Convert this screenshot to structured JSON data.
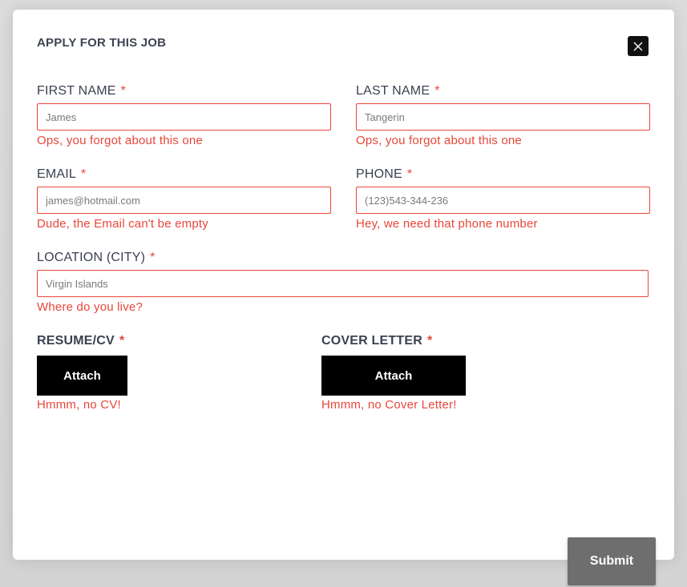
{
  "modal": {
    "title": "APPLY FOR THIS JOB",
    "close_icon": "close-icon"
  },
  "form": {
    "first_name": {
      "label": "FIRST NAME",
      "required_mark": "*",
      "placeholder": "James",
      "error": "Ops, you forgot about this one"
    },
    "last_name": {
      "label": "LAST NAME",
      "required_mark": "*",
      "placeholder": "Tangerin",
      "error": "Ops, you forgot about this one"
    },
    "email": {
      "label": "EMAIL",
      "required_mark": "*",
      "placeholder": "james@hotmail.com",
      "error": "Dude, the Email can't be empty"
    },
    "phone": {
      "label": "PHONE",
      "required_mark": "*",
      "placeholder": "(123)543-344-236",
      "error": "Hey, we need that phone number"
    },
    "location": {
      "label": "LOCATION (CITY)",
      "required_mark": "*",
      "placeholder": "Virgin Islands",
      "error": "Where do you live?"
    },
    "resume": {
      "label": "RESUME/CV",
      "required_mark": "*",
      "button_label": "Attach",
      "error": "Hmmm, no CV!"
    },
    "cover_letter": {
      "label": "COVER LETTER",
      "required_mark": "*",
      "button_label": "Attach",
      "error": "Hmmm, no Cover Letter!"
    },
    "submit_label": "Submit"
  },
  "colors": {
    "error": "#e8463a",
    "label": "#3a4150",
    "button_dark": "#000000",
    "submit": "#6e6e6e"
  }
}
